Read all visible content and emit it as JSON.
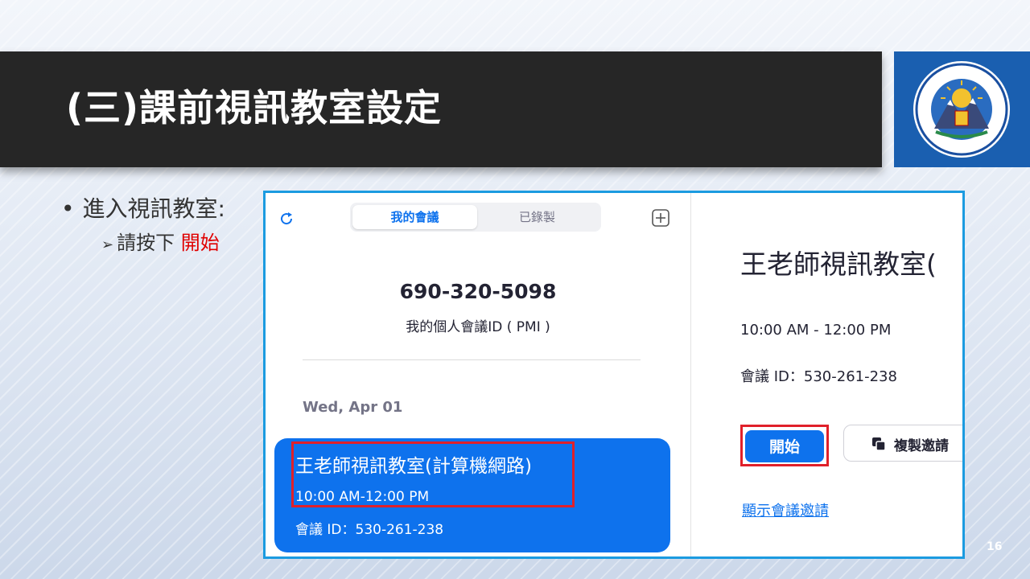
{
  "slide": {
    "title": "(三)課前視訊教室設定",
    "bullet": "進入視訊教室:",
    "sub_bullet_prefix": "請按下",
    "sub_bullet_highlight": "開始",
    "page_number": "16"
  },
  "zoom": {
    "tabs": [
      {
        "label": "我的會議",
        "active": true
      },
      {
        "label": "已錄製",
        "active": false
      }
    ],
    "pmi": {
      "number": "690-320-5098",
      "label": "我的個人會議ID ( PMI )"
    },
    "date_header": "Wed, Apr 01",
    "meeting_card": {
      "title": "王老師視訊教室(計算機網路)",
      "time": "10:00 AM-12:00 PM",
      "meeting_id": "會議 ID：530-261-238"
    },
    "detail": {
      "title": "王老師視訊教室(",
      "time": "10:00 AM - 12:00 PM",
      "meeting_id": "會議 ID：530-261-238",
      "start_label": "開始",
      "copy_label": "複製邀請",
      "show_invite_label": "顯示會議邀請"
    }
  },
  "colors": {
    "accent": "#0e72ed",
    "highlight_border": "#e0202a",
    "title_bar": "#262626",
    "logo_bg": "#1a5fb0"
  },
  "icons": [
    "refresh-icon",
    "plus-icon",
    "copy-icon",
    "university-logo"
  ]
}
